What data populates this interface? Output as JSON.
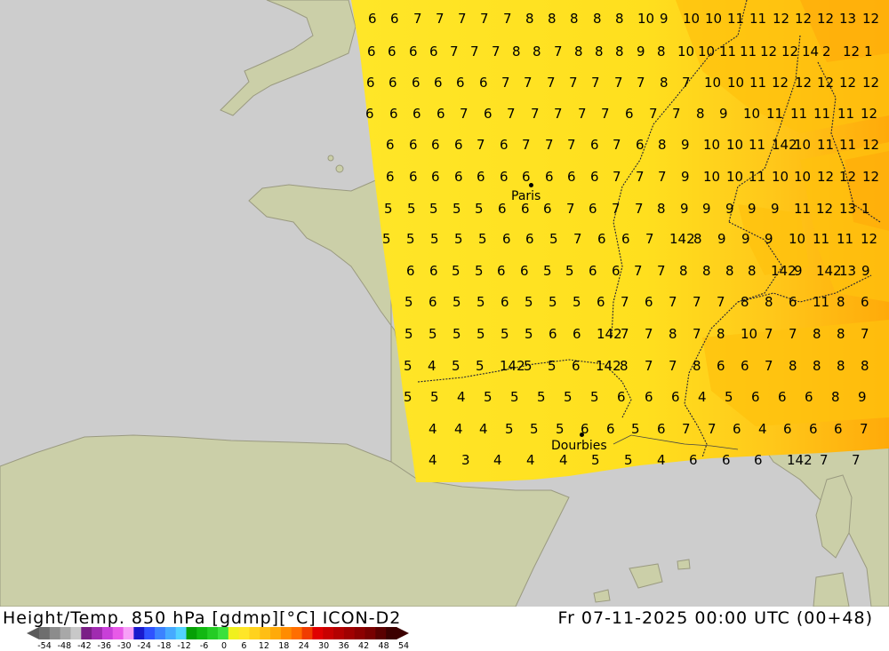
{
  "header": {
    "product": "Height/Temp. 850 hPa [gdmp][°C] ICON-D2",
    "valid_time": "Fr 07-11-2025 00:00 UTC (00+48)"
  },
  "cities": [
    {
      "name": "Paris"
    },
    {
      "name": "Dourbies"
    }
  ],
  "colorscale": {
    "ticks": [
      "-54",
      "-48",
      "-42",
      "-36",
      "-30",
      "-24",
      "-18",
      "-12",
      "-6",
      "0",
      "6",
      "12",
      "18",
      "24",
      "30",
      "36",
      "42",
      "48",
      "54"
    ],
    "colors": [
      "#6e6e6e",
      "#8c8c8c",
      "#a8a8a8",
      "#c8c8c8",
      "#7a1f86",
      "#a02bb0",
      "#c83fd8",
      "#e85ae8",
      "#f7a0f7",
      "#1a1acd",
      "#2f52ff",
      "#3c82ff",
      "#46aaff",
      "#52d2ff",
      "#06a006",
      "#12b812",
      "#24cc24",
      "#3ce03c",
      "#f0f01e",
      "#ffe628",
      "#ffd21e",
      "#ffbe14",
      "#ffaa0a",
      "#ff8c00",
      "#ff6e00",
      "#f03c00",
      "#e00000",
      "#c80000",
      "#b40000",
      "#a00000",
      "#8c0000",
      "#780000",
      "#5a0000",
      "#3c0000"
    ]
  },
  "temperature_labels": [
    {
      "row": 1,
      "values": [
        "6",
        "6",
        "7",
        "7",
        "7",
        "7",
        "7",
        "8",
        "8",
        "8",
        "8",
        "8",
        "10",
        "9",
        "10",
        "10",
        "11",
        "11",
        "12",
        "12",
        "12",
        "13",
        "12"
      ]
    },
    {
      "row": 2,
      "values": [
        "6",
        "6",
        "6",
        "6",
        "7",
        "7",
        "7",
        "8",
        "8",
        "7",
        "8",
        "8",
        "8",
        "9",
        "8",
        "10",
        "10",
        "11",
        "11",
        "12",
        "12",
        "14",
        "2",
        "12",
        "1"
      ]
    },
    {
      "row": 3,
      "values": [
        "6",
        "6",
        "6",
        "6",
        "6",
        "6",
        "7",
        "7",
        "7",
        "7",
        "7",
        "7",
        "7",
        "8",
        "7",
        "10",
        "10",
        "11",
        "12",
        "12",
        "12",
        "12",
        "12"
      ]
    },
    {
      "row": 4,
      "values": [
        "6",
        "6",
        "6",
        "6",
        "7",
        "6",
        "7",
        "7",
        "7",
        "7",
        "7",
        "6",
        "7",
        "7",
        "8",
        "9",
        "10",
        "11",
        "11",
        "11",
        "11",
        "12"
      ]
    },
    {
      "row": 5,
      "values": [
        "6",
        "6",
        "6",
        "6",
        "7",
        "6",
        "7",
        "7",
        "7",
        "6",
        "7",
        "6",
        "8",
        "9",
        "10",
        "10",
        "11",
        "142",
        "10",
        "11",
        "11",
        "12"
      ]
    },
    {
      "row": 6,
      "values": [
        "6",
        "6",
        "6",
        "6",
        "6",
        "6",
        "6",
        "6",
        "6",
        "6",
        "7",
        "7",
        "7",
        "9",
        "10",
        "10",
        "11",
        "10",
        "10",
        "12",
        "12",
        "12"
      ]
    },
    {
      "row": 7,
      "values": [
        "5",
        "5",
        "5",
        "5",
        "5",
        "6",
        "6",
        "6",
        "7",
        "6",
        "7",
        "7",
        "8",
        "9",
        "9",
        "9",
        "9",
        "9",
        "11",
        "12",
        "13",
        "1"
      ]
    },
    {
      "row": 8,
      "values": [
        "5",
        "5",
        "5",
        "5",
        "5",
        "6",
        "6",
        "5",
        "7",
        "6",
        "6",
        "7",
        "142",
        "8",
        "9",
        "9",
        "9",
        "10",
        "11",
        "11",
        "12"
      ]
    },
    {
      "row": 9,
      "values": [
        "6",
        "6",
        "5",
        "5",
        "6",
        "6",
        "5",
        "5",
        "6",
        "6",
        "7",
        "7",
        "8",
        "8",
        "8",
        "8",
        "142",
        "9",
        "142",
        "13",
        "9"
      ]
    },
    {
      "row": 10,
      "values": [
        "5",
        "6",
        "5",
        "5",
        "6",
        "5",
        "5",
        "5",
        "6",
        "7",
        "6",
        "7",
        "7",
        "7",
        "8",
        "8",
        "6",
        "11",
        "8",
        "6"
      ]
    },
    {
      "row": 11,
      "values": [
        "5",
        "5",
        "5",
        "5",
        "5",
        "5",
        "6",
        "6",
        "142",
        "7",
        "7",
        "8",
        "7",
        "8",
        "10",
        "7",
        "7",
        "8",
        "8",
        "7"
      ]
    },
    {
      "row": 12,
      "values": [
        "5",
        "4",
        "5",
        "5",
        "142",
        "5",
        "5",
        "6",
        "142",
        "8",
        "7",
        "7",
        "8",
        "6",
        "6",
        "7",
        "8",
        "8",
        "8",
        "8"
      ]
    },
    {
      "row": 13,
      "values": [
        "5",
        "5",
        "4",
        "5",
        "5",
        "5",
        "5",
        "5",
        "6",
        "6",
        "6",
        "4",
        "5",
        "6",
        "6",
        "6",
        "8",
        "9"
      ]
    },
    {
      "row": 14,
      "values": [
        "4",
        "4",
        "4",
        "5",
        "5",
        "5",
        "6",
        "6",
        "5",
        "6",
        "7",
        "7",
        "6",
        "4",
        "6",
        "6",
        "6",
        "7"
      ]
    },
    {
      "row": 15,
      "values": [
        "4",
        "3",
        "4",
        "4",
        "4",
        "5",
        "5",
        "4",
        "6",
        "6",
        "6",
        "142",
        "7",
        "7"
      ]
    }
  ]
}
